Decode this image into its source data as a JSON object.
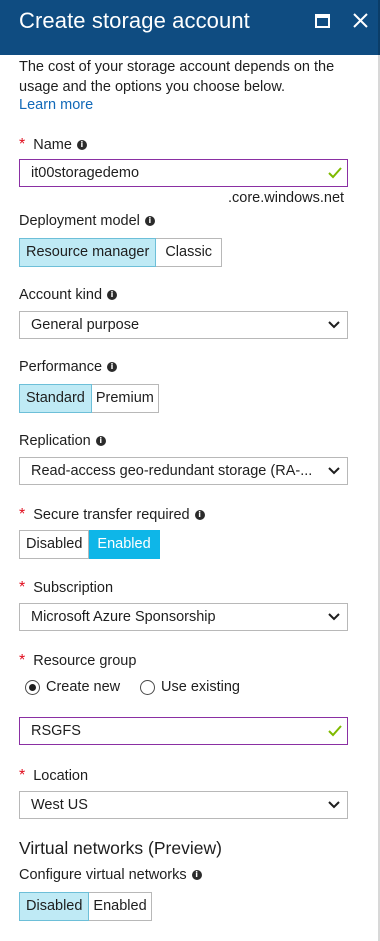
{
  "header": {
    "title": "Create storage account"
  },
  "intro": {
    "text": "The cost of your storage account depends on the usage and the options you choose below.",
    "learn_more": "Learn more"
  },
  "name": {
    "label": "Name",
    "value": "it00storagedemo",
    "suffix": ".core.windows.net"
  },
  "deployment": {
    "label": "Deployment model",
    "options": [
      "Resource manager",
      "Classic"
    ],
    "selected": "Resource manager"
  },
  "account_kind": {
    "label": "Account kind",
    "value": "General purpose"
  },
  "performance": {
    "label": "Performance",
    "options": [
      "Standard",
      "Premium"
    ],
    "selected": "Standard"
  },
  "replication": {
    "label": "Replication",
    "value": "Read-access geo-redundant storage (RA-..."
  },
  "secure_transfer": {
    "label": "Secure transfer required",
    "options": [
      "Disabled",
      "Enabled"
    ],
    "selected": "Enabled"
  },
  "subscription": {
    "label": "Subscription",
    "value": "Microsoft Azure Sponsorship"
  },
  "resource_group": {
    "label": "Resource group",
    "radio_new": "Create new",
    "radio_existing": "Use existing",
    "selected": "Create new",
    "value": "RSGFS"
  },
  "location": {
    "label": "Location",
    "value": "West US"
  },
  "vnet": {
    "section_title": "Virtual networks (Preview)",
    "label": "Configure virtual networks",
    "options": [
      "Disabled",
      "Enabled"
    ],
    "selected": "Disabled"
  },
  "colors": {
    "header_bg": "#0f4c81",
    "link": "#1169b8",
    "required": "#e00b1c",
    "valid_check": "#7fba00",
    "focus_border": "#8a2fa3",
    "selected_light": "#bfeaf5",
    "selected_dark": "#0eb6e8"
  }
}
